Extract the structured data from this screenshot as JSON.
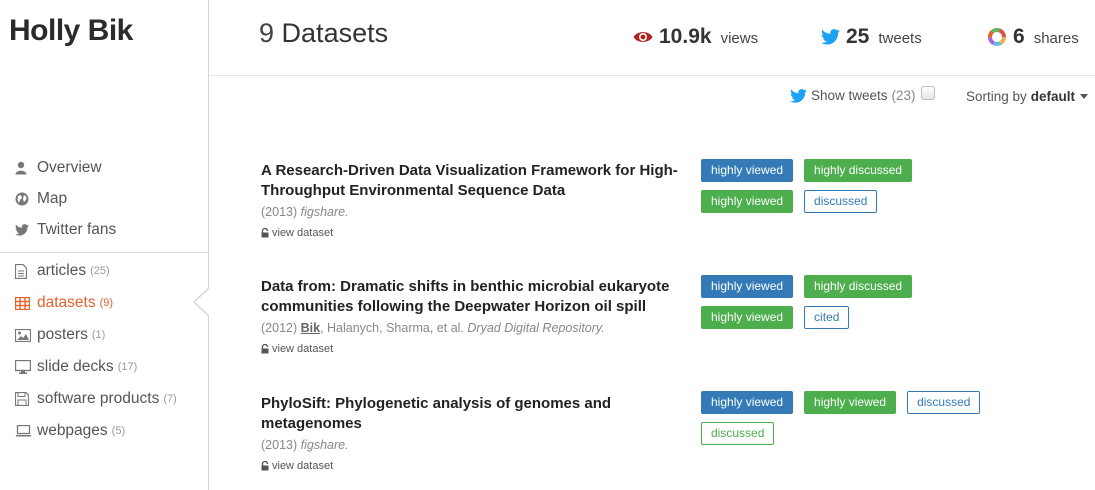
{
  "profile": {
    "name": "Holly Bik"
  },
  "nav": {
    "top": [
      {
        "label": "Overview",
        "icon": "user-icon"
      },
      {
        "label": "Map",
        "icon": "globe-icon"
      },
      {
        "label": "Twitter fans",
        "icon": "twitter-icon"
      }
    ],
    "bottom": [
      {
        "label": "articles",
        "count": "(25)",
        "icon": "document-icon"
      },
      {
        "label": "datasets",
        "count": "(9)",
        "icon": "table-icon",
        "active": true
      },
      {
        "label": "posters",
        "count": "(1)",
        "icon": "image-icon"
      },
      {
        "label": "slide decks",
        "count": "(17)",
        "icon": "monitor-icon"
      },
      {
        "label": "software products",
        "count": "(7)",
        "icon": "floppy-icon"
      },
      {
        "label": "webpages",
        "count": "(5)",
        "icon": "laptop-icon"
      }
    ]
  },
  "header": {
    "count": "9",
    "title": "Datasets",
    "views_value": "10.9k",
    "views_label": "views",
    "tweets_value": "25",
    "tweets_label": "tweets",
    "shares_value": "6",
    "shares_label": "shares"
  },
  "toolbar": {
    "show_tweets_label": "Show tweets",
    "show_tweets_count": "(23)",
    "sorting_label": "Sorting by",
    "sorting_value": "default"
  },
  "datasets": [
    {
      "title": "A Research-Driven Data Visualization Framework for High-Throughput Environmental Sequence Data",
      "year": "(2013)",
      "authors_me": "",
      "authors_rest": "",
      "source": "figshare.",
      "link": "view dataset",
      "badges": [
        "highly viewed",
        "highly discussed",
        "highly viewed",
        "discussed"
      ]
    },
    {
      "title": "Data from: Dramatic shifts in benthic microbial eukaryote communities following the Deepwater Horizon oil spill",
      "year": "(2012)",
      "authors_me": "Bik",
      "authors_rest": ", Halanych, Sharma, et al.",
      "source": "Dryad Digital Repository.",
      "link": "view dataset",
      "badges": [
        "highly viewed",
        "highly discussed",
        "highly viewed",
        "cited"
      ]
    },
    {
      "title": "PhyloSift: Phylogenetic analysis of genomes and metagenomes",
      "year": "(2013)",
      "authors_me": "",
      "authors_rest": "",
      "source": "figshare.",
      "link": "view dataset",
      "badges": [
        "highly viewed",
        "highly viewed",
        "discussed",
        "discussed"
      ]
    }
  ],
  "colors": {
    "accent": "#e2632d",
    "badge_blue": "#337ab7",
    "badge_green": "#4cae4c",
    "views_icon": "#b22222",
    "twitter": "#1da1f2"
  }
}
